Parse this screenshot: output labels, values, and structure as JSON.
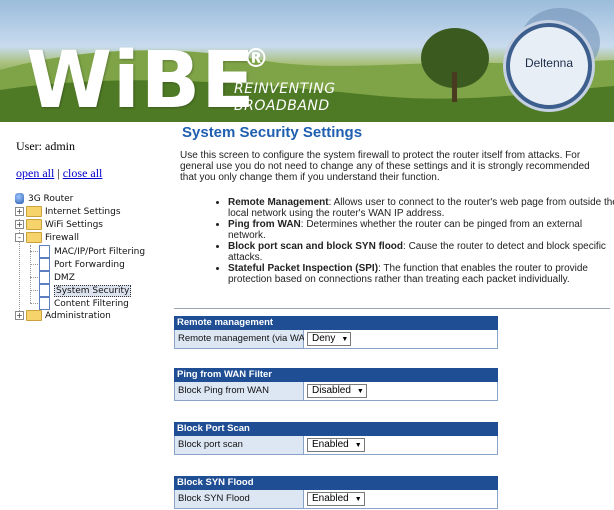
{
  "banner": {
    "brand": "WiBE",
    "reg": "®",
    "tagline_1": "REINVENTING",
    "tagline_2": "BROADBAND",
    "logo": "Deltenna",
    "colors": {
      "primary_blue": "#1f4e94",
      "title_blue": "#1f5fb0",
      "label_bg": "#dde7f4"
    }
  },
  "sidebar": {
    "user": "User: admin",
    "open_all": "open all",
    "separator": "|",
    "close_all": "close all",
    "tree": [
      {
        "label": "3G Router",
        "icon": "globe-icon"
      },
      {
        "label": "Internet Settings",
        "icon": "folder-icon",
        "toggle": "+"
      },
      {
        "label": "WiFi Settings",
        "icon": "folder-icon",
        "toggle": "+"
      },
      {
        "label": "Firewall",
        "icon": "folder-icon",
        "toggle": "-"
      },
      {
        "label": "MAC/IP/Port Filtering",
        "icon": "page-icon"
      },
      {
        "label": "Port Forwarding",
        "icon": "page-icon"
      },
      {
        "label": "DMZ",
        "icon": "page-icon"
      },
      {
        "label": "System Security",
        "icon": "page-icon",
        "selected": true
      },
      {
        "label": "Content Filtering",
        "icon": "page-icon"
      },
      {
        "label": "Administration",
        "icon": "folder-icon",
        "toggle": "+"
      }
    ]
  },
  "main": {
    "title": "System Security Settings",
    "intro": "Use this screen to configure the system firewall to protect the router itself from attacks. For general use you do not need to change any of these settings and it is strongly recommended that you only change them if you understand their function.",
    "bullets": [
      {
        "term": "Remote Management",
        "text": ": Allows user to connect to the router's web page from outside the local network using the router's WAN IP address."
      },
      {
        "term": "Ping from WAN",
        "text": ": Determines whether the router can be pinged from an external network."
      },
      {
        "term": "Block port scan and block SYN flood",
        "text": ": Cause the router to detect and block specific attacks."
      },
      {
        "term": "Stateful Packet Inspection (SPI)",
        "text": ": The function that enables the router to provide protection based on connections rather than treating each packet individually."
      }
    ],
    "sections": [
      {
        "header": "Remote management",
        "label": "Remote management (via WAN)",
        "value": "Deny"
      },
      {
        "header": "Ping from WAN Filter",
        "label": "Block Ping from WAN",
        "value": "Disabled"
      },
      {
        "header": "Block Port Scan",
        "label": "Block port scan",
        "value": "Enabled"
      },
      {
        "header": "Block SYN Flood",
        "label": "Block SYN Flood",
        "value": "Enabled"
      }
    ]
  }
}
